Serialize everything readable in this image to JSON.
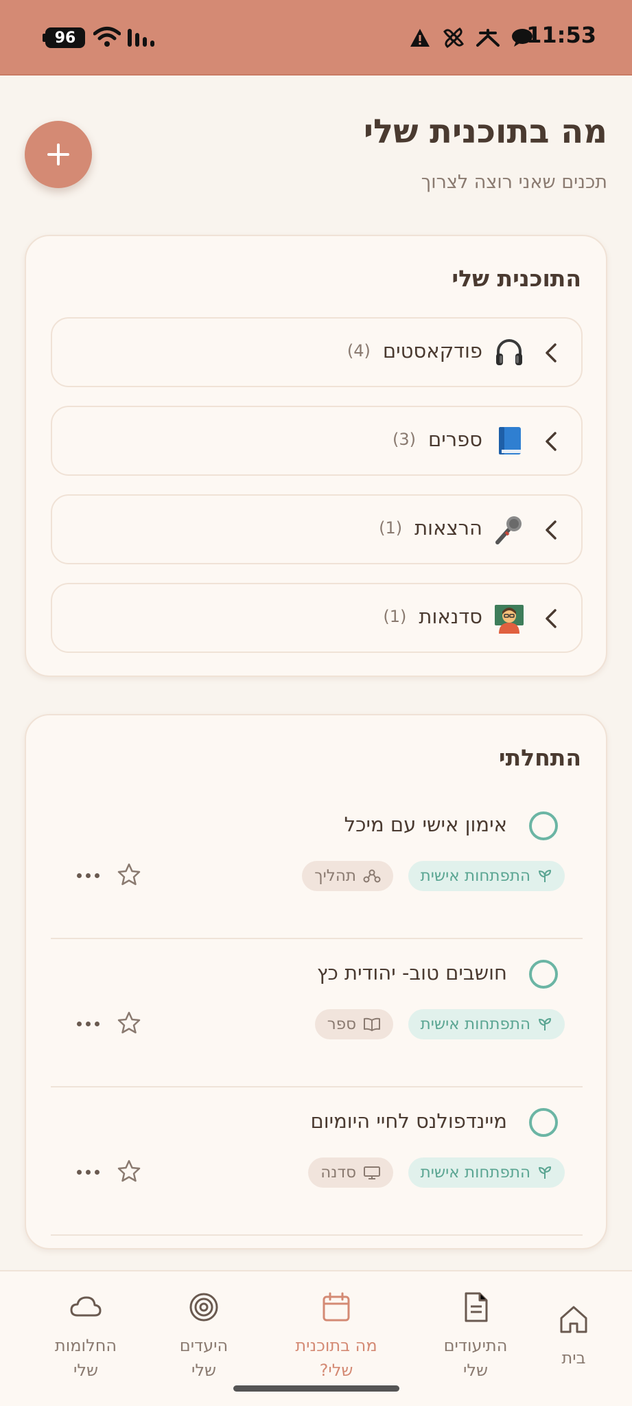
{
  "status_bar": {
    "battery": "96",
    "time": "11:53"
  },
  "header": {
    "title": "מה בתוכנית שלי",
    "subtitle": "תכנים שאני רוצה לצרוך"
  },
  "plan_card": {
    "title": "התוכנית שלי",
    "categories": [
      {
        "label": "פודקאסטים",
        "count": "(4)",
        "icon": "headphones-emoji"
      },
      {
        "label": "ספרים",
        "count": "(3)",
        "icon": "blue-book-emoji"
      },
      {
        "label": "הרצאות",
        "count": "(1)",
        "icon": "microphone-emoji"
      },
      {
        "label": "סדנאות",
        "count": "(1)",
        "icon": "teacher-emoji"
      }
    ]
  },
  "started_card": {
    "title": "התחלתי",
    "items": [
      {
        "title": "אימון אישי עם מיכל",
        "category_tag": "התפתחות אישית",
        "type_tag": "תהליך",
        "type_icon": "process-icon"
      },
      {
        "title": "חושבים טוב- יהודית כץ",
        "category_tag": "התפתחות אישית",
        "type_tag": "ספר",
        "type_icon": "book-icon"
      },
      {
        "title": "מיינדפולנס לחיי היומיום",
        "category_tag": "התפתחות אישית",
        "type_tag": "סדנה",
        "type_icon": "presentation-icon"
      }
    ]
  },
  "bottom_nav": {
    "items": [
      {
        "line1": "החלומות",
        "line2": "שלי",
        "icon": "cloud-icon"
      },
      {
        "line1": "היעדים",
        "line2": "שלי",
        "icon": "target-icon"
      },
      {
        "line1": "מה בתוכנית",
        "line2": "שלי?",
        "icon": "calendar-icon",
        "active": true
      },
      {
        "line1": "התיעודים",
        "line2": "שלי",
        "icon": "document-icon"
      },
      {
        "line1": "בית",
        "line2": "",
        "icon": "home-icon"
      }
    ]
  },
  "colors": {
    "accent": "#d48a74",
    "teal": "#6bb5a4",
    "background": "#f9f4ee"
  }
}
